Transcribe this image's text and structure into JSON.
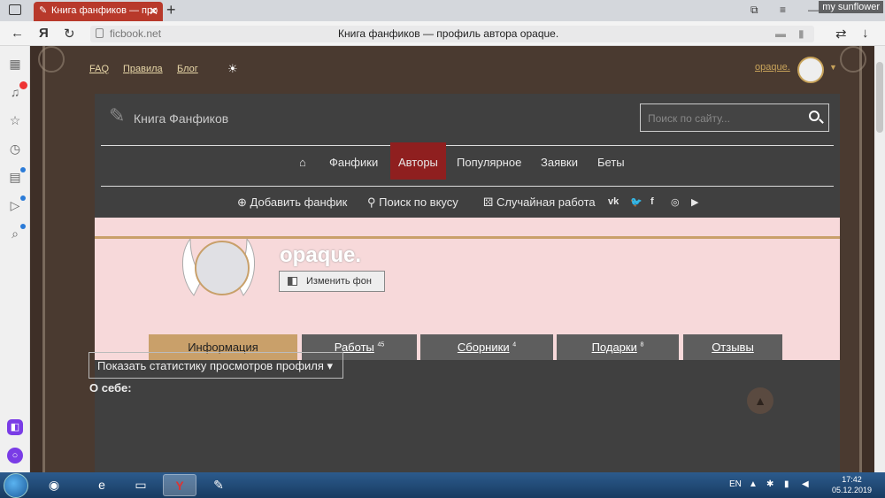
{
  "browser": {
    "tab_title": "Книга фанфиков — про",
    "address_domain": "ficbook.net",
    "page_title": "Книга фанфиков — профиль автора opaque.",
    "watermark": "my sunflower"
  },
  "site": {
    "topnav": [
      "FAQ",
      "Правила",
      "Блог"
    ],
    "username_link": "opaque.",
    "logo_text": "Книга Фанфиков",
    "search_placeholder": "Поиск по сайту...",
    "menu": [
      "Фанфики",
      "Авторы",
      "Популярное",
      "Заявки",
      "Беты"
    ],
    "menu_active": "Авторы",
    "submenu": [
      "Добавить фанфик",
      "Поиск по вкусу",
      "Случайная работа"
    ],
    "social_icons": [
      "vk-icon",
      "twitter-icon",
      "facebook-icon",
      "instagram-icon",
      "youtube-icon"
    ]
  },
  "profile": {
    "name": "opaque.",
    "change_bg_label": "Изменить фон",
    "tabs": [
      {
        "label": "Информация",
        "count": ""
      },
      {
        "label": "Работы",
        "count": "45"
      },
      {
        "label": "Сборники",
        "count": "4"
      },
      {
        "label": "Подарки",
        "count": "8"
      },
      {
        "label": "Отзывы",
        "count": ""
      }
    ],
    "active_tab": "Информация",
    "stats_button": "Показать статистику просмотров профиля",
    "about_heading": "О себе:"
  },
  "taskbar": {
    "lang": "EN",
    "time": "17:42",
    "date": "05.12.2019"
  },
  "colors": {
    "tab_red": "#b8392b",
    "menu_active": "#8f1f1f",
    "profile_bg": "#f7d9da",
    "tab_active": "#c9a06a",
    "panel_bg": "#404040"
  }
}
